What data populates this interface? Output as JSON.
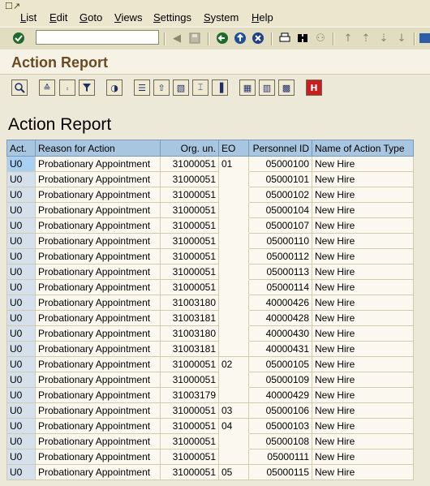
{
  "menu": {
    "items": [
      {
        "label": "List",
        "u": "L",
        "rest": "ist"
      },
      {
        "label": "Edit",
        "u": "E",
        "rest": "dit"
      },
      {
        "label": "Goto",
        "u": "G",
        "rest": "oto"
      },
      {
        "label": "Views",
        "u": "V",
        "rest": "iews"
      },
      {
        "label": "Settings",
        "u": "S",
        "rest": "ettings"
      },
      {
        "label": "System",
        "u": "S",
        "rest": "ystem"
      },
      {
        "label": "Help",
        "u": "H",
        "rest": "elp"
      }
    ]
  },
  "okcode": {
    "value": ""
  },
  "title": "Action Report",
  "report": {
    "heading": "Action Report",
    "columns": [
      "Act.",
      "Reason for Action",
      "Org. un.",
      "EO",
      "Personnel ID",
      "Name of Action Type"
    ],
    "rows": [
      [
        "U0",
        "Probationary Appointment",
        "31000051",
        "01",
        "05000100",
        "New Hire"
      ],
      [
        "U0",
        "Probationary Appointment",
        "31000051",
        "",
        "05000101",
        "New Hire"
      ],
      [
        "U0",
        "Probationary Appointment",
        "31000051",
        "",
        "05000102",
        "New Hire"
      ],
      [
        "U0",
        "Probationary Appointment",
        "31000051",
        "",
        "05000104",
        "New Hire"
      ],
      [
        "U0",
        "Probationary Appointment",
        "31000051",
        "",
        "05000107",
        "New Hire"
      ],
      [
        "U0",
        "Probationary Appointment",
        "31000051",
        "",
        "05000110",
        "New Hire"
      ],
      [
        "U0",
        "Probationary Appointment",
        "31000051",
        "",
        "05000112",
        "New Hire"
      ],
      [
        "U0",
        "Probationary Appointment",
        "31000051",
        "",
        "05000113",
        "New Hire"
      ],
      [
        "U0",
        "Probationary Appointment",
        "31000051",
        "",
        "05000114",
        "New Hire"
      ],
      [
        "U0",
        "Probationary Appointment",
        "31003180",
        "",
        "40000426",
        "New Hire"
      ],
      [
        "U0",
        "Probationary Appointment",
        "31003181",
        "",
        "40000428",
        "New Hire"
      ],
      [
        "U0",
        "Probationary Appointment",
        "31003180",
        "",
        "40000430",
        "New Hire"
      ],
      [
        "U0",
        "Probationary Appointment",
        "31003181",
        "",
        "40000431",
        "New Hire"
      ],
      [
        "U0",
        "Probationary Appointment",
        "31000051",
        "02",
        "05000105",
        "New Hire"
      ],
      [
        "U0",
        "Probationary Appointment",
        "31000051",
        "",
        "05000109",
        "New Hire"
      ],
      [
        "U0",
        "Probationary Appointment",
        "31003179",
        "",
        "40000429",
        "New Hire"
      ],
      [
        "U0",
        "Probationary Appointment",
        "31000051",
        "03",
        "05000106",
        "New Hire"
      ],
      [
        "U0",
        "Probationary Appointment",
        "31000051",
        "04",
        "05000103",
        "New Hire"
      ],
      [
        "U0",
        "Probationary Appointment",
        "31000051",
        "",
        "05000108",
        "New Hire"
      ],
      [
        "U0",
        "Probationary Appointment",
        "31000051",
        "",
        "05000111",
        "New Hire"
      ],
      [
        "U0",
        "Probationary Appointment",
        "31000051",
        "05",
        "05000115",
        "New Hire"
      ]
    ]
  },
  "icons": {
    "standard_toolbar": [
      "enter-icon",
      "save-icon",
      "back-icon",
      "exit-icon",
      "cancel-icon",
      "print-icon",
      "find-icon",
      "find-next-icon",
      "first-page-icon",
      "previous-page-icon",
      "next-page-icon",
      "last-page-icon"
    ],
    "app_toolbar": [
      "details-icon",
      "sort-ascending-icon",
      "sort-descending-icon",
      "filter-icon",
      "total-icon",
      "export-icon",
      "word-processing-icon",
      "spreadsheet-icon",
      "local-file-icon",
      "abc-analysis-icon",
      "graphic-icon",
      "change-layout-icon",
      "select-layout-icon",
      "save-layout-icon",
      "information-icon"
    ]
  }
}
